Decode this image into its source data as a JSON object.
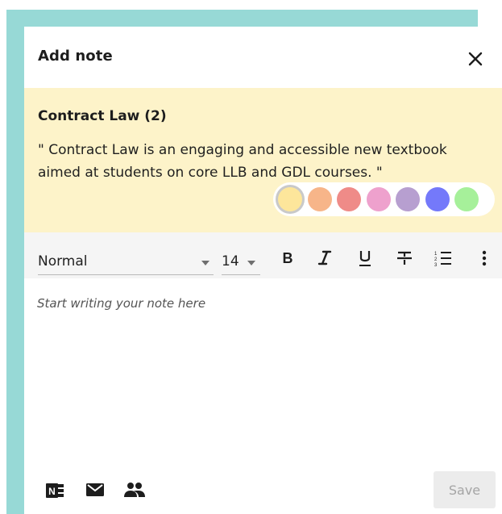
{
  "dialog": {
    "title": "Add note",
    "close_icon": "close-icon"
  },
  "highlight": {
    "title": "Contract Law (2)",
    "quote": "\" Contract Law is an engaging and accessible new textbook aimed at students on core LLB and GDL courses. \"",
    "background_color": "#fdf3c9"
  },
  "color_picker": {
    "selected": "yellow",
    "swatches": [
      {
        "name": "yellow",
        "color": "#fde69b"
      },
      {
        "name": "orange",
        "color": "#f7b589"
      },
      {
        "name": "red",
        "color": "#ef8b88"
      },
      {
        "name": "pink",
        "color": "#eea1cd"
      },
      {
        "name": "purple",
        "color": "#b79fd0"
      },
      {
        "name": "blue",
        "color": "#7479fa"
      },
      {
        "name": "green",
        "color": "#a6f09a"
      }
    ]
  },
  "toolbar": {
    "text_style": "Normal",
    "font_size": "14",
    "buttons": [
      {
        "name": "bold-icon"
      },
      {
        "name": "italic-icon"
      },
      {
        "name": "underline-icon"
      },
      {
        "name": "strikethrough-icon"
      },
      {
        "name": "numbered-list-icon"
      },
      {
        "name": "more-options-icon"
      }
    ]
  },
  "editor": {
    "placeholder": "Start writing your note here"
  },
  "footer": {
    "icons": [
      "onenote-icon",
      "email-icon",
      "share-people-icon"
    ],
    "save_label": "Save"
  },
  "theme": {
    "backdrop_color": "#97d9d6",
    "toolbar_bg": "#f5f5f5"
  }
}
